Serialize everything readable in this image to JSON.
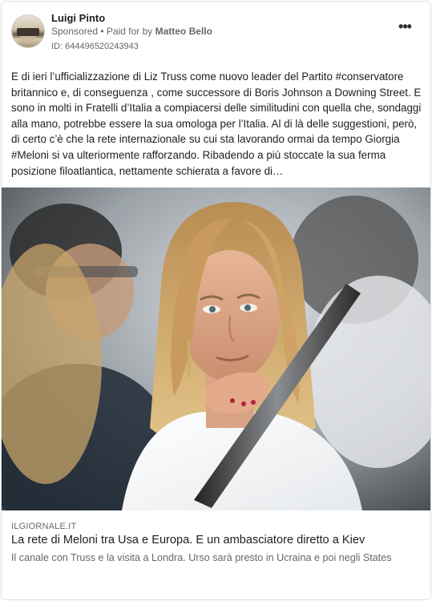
{
  "post": {
    "author_name": "Luigi Pinto",
    "sponsored_label": "Sponsored",
    "paid_for_prefix": " • Paid for by ",
    "paid_for_name": "Matteo Bello",
    "ad_id": "ID: 644496520243943",
    "more_icon": "more-horizontal-icon",
    "body_text": "E di ieri l’ufficializzazione di Liz Truss come nuovo leader del Partito #conservatore britannico e, di conseguenza , come successore di Boris Johnson a Downing Street. E sono in molti in Fratelli d’Italia a compiacersi delle similitudini con quella che, sondaggi alla mano, potrebbe essere la sua omologa per l’Italia. Al di là delle suggestioni, però, di certo c’è che la rete internazionale su cui sta lavorando ormai da tempo Giorgia #Meloni si va ulteriormente rafforzando. Ribadendo a più stoccate la sua ferma posizione filoatlantica, nettamente schierata a favore di…"
  },
  "link_preview": {
    "domain": "ILGIORNALE.IT",
    "headline": "La rete di Meloni tra Usa e Europa. E un ambasciatore diretto a Kiev",
    "description": "Il canale con Truss e la visita a Londra. Urso sarà presto in Ucraina e poi negli States"
  }
}
